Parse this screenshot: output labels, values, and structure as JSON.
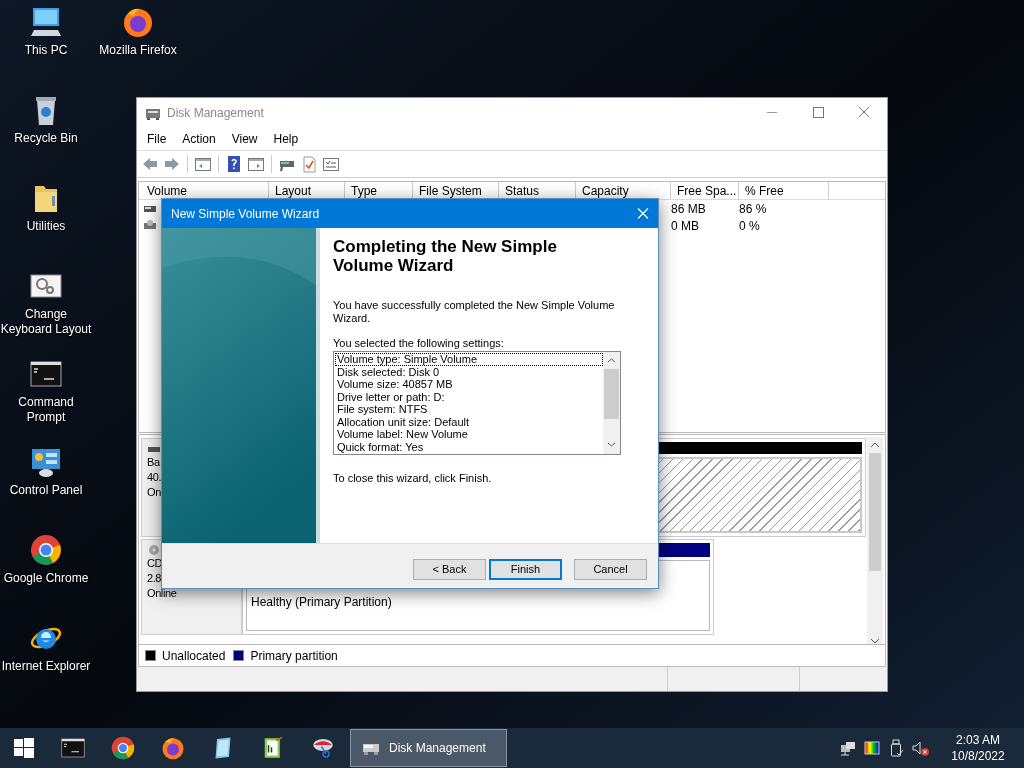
{
  "desktop_icons": [
    {
      "label": "This PC",
      "kind": "pc"
    },
    {
      "label": "Recycle Bin",
      "kind": "recycle"
    },
    {
      "label": "Utilities",
      "kind": "folder"
    },
    {
      "label": "Change Keyboard Layout",
      "kind": "settings"
    },
    {
      "label": "Command Prompt",
      "kind": "cmd"
    },
    {
      "label": "Control Panel",
      "kind": "control"
    },
    {
      "label": "Google Chrome",
      "kind": "chrome"
    },
    {
      "label": "Internet Explorer",
      "kind": "ie"
    },
    {
      "label": "Mozilla Firefox",
      "kind": "firefox"
    }
  ],
  "window": {
    "title": "Disk Management",
    "menu": [
      "File",
      "Action",
      "View",
      "Help"
    ],
    "columns": [
      "Volume",
      "Layout",
      "Type",
      "File System",
      "Status",
      "Capacity",
      "Free Spa...",
      "% Free"
    ],
    "rows": [
      {
        "free_space": "86 MB",
        "percent_free": "86 %"
      },
      {
        "free_space": "0 MB",
        "percent_free": "0 %"
      }
    ],
    "disks": [
      {
        "kind": "disk",
        "lines": [
          "Ba",
          "40.",
          "On"
        ],
        "partition": {
          "kind": "unallocated"
        }
      },
      {
        "kind": "cd",
        "lines": [
          "CD",
          "2.8",
          "Online"
        ],
        "partition": {
          "kind": "primary",
          "status": "Healthy (Primary Partition)"
        }
      }
    ],
    "legend": [
      {
        "label": "Unallocated",
        "kind": "unallocated",
        "color": "#000000"
      },
      {
        "label": "Primary partition",
        "kind": "primary",
        "color": "#000080"
      }
    ]
  },
  "wizard": {
    "title": "New Simple Volume Wizard",
    "heading": "Completing the New Simple Volume Wizard",
    "intro": "You have successfully completed the New Simple Volume Wizard.",
    "settings_label": "You selected the following settings:",
    "settings": [
      {
        "text": "Volume type: Simple Volume",
        "selected": true
      },
      {
        "text": "Disk selected: Disk 0",
        "selected": false
      },
      {
        "text": "Volume size: 40857 MB",
        "selected": false
      },
      {
        "text": "Drive letter or path: D:",
        "selected": false
      },
      {
        "text": "File system: NTFS",
        "selected": false
      },
      {
        "text": "Allocation unit size: Default",
        "selected": false
      },
      {
        "text": "Volume label: New Volume",
        "selected": false
      },
      {
        "text": "Quick format: Yes",
        "selected": false
      }
    ],
    "closing": "To close this wizard, click Finish.",
    "buttons": [
      {
        "label": "< Back",
        "default": false
      },
      {
        "label": "Finish",
        "default": true
      },
      {
        "label": "Cancel",
        "default": false
      }
    ]
  },
  "taskbar": {
    "apps": [
      {
        "label": "Disk Management",
        "selected": true
      }
    ],
    "time": "2:03 AM",
    "date": "10/8/2022"
  }
}
